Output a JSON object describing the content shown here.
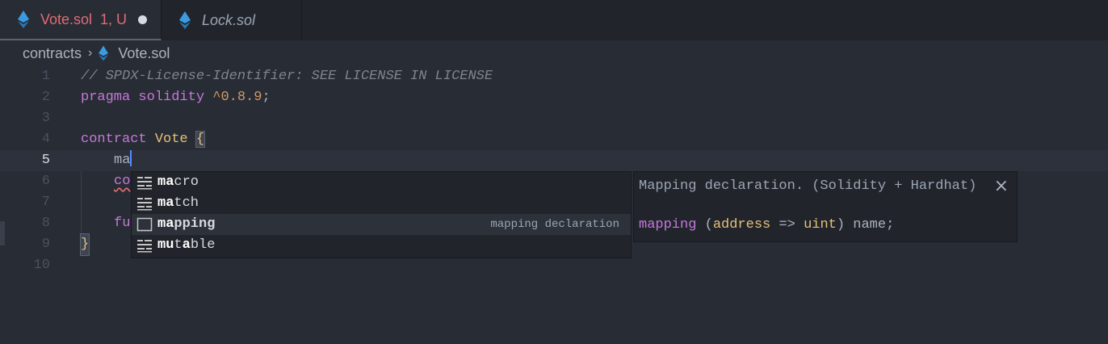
{
  "tabs": [
    {
      "name": "Vote.sol",
      "status": "1, U",
      "active": true,
      "modified": true
    },
    {
      "name": "Lock.sol",
      "active": false
    }
  ],
  "breadcrumb": {
    "folder": "contracts",
    "file": "Vote.sol"
  },
  "editor": {
    "current_line": 5,
    "lines": [
      {
        "n": "1"
      },
      {
        "n": "2"
      },
      {
        "n": "3"
      },
      {
        "n": "4"
      },
      {
        "n": "5"
      },
      {
        "n": "6"
      },
      {
        "n": "7"
      },
      {
        "n": "8"
      },
      {
        "n": "9"
      },
      {
        "n": "10"
      }
    ],
    "code": {
      "l1": "// SPDX-License-Identifier: SEE LICENSE IN LICENSE",
      "l2_kw": "pragma",
      "l2_kw2": "solidity",
      "l2_ver": "^0.8.9",
      "l2_end": ";",
      "l4_kw": "contract",
      "l4_name": "Vote",
      "l4_brace": "{",
      "l5": "ma",
      "l6": "co",
      "l8": "fu",
      "l9": "}"
    }
  },
  "suggest": {
    "items": [
      {
        "match": "ma",
        "rest": "cro",
        "detail": ""
      },
      {
        "match": "ma",
        "rest": "tch",
        "detail": ""
      },
      {
        "match": "ma",
        "rest": "pping",
        "detail": "mapping declaration",
        "selected": true
      },
      {
        "match": "mu",
        "mid": "t",
        "match2": "a",
        "rest": "ble",
        "detail": ""
      }
    ]
  },
  "details": {
    "title": "Mapping declaration. (Solidity + Hardhat)",
    "close": "×",
    "snippet": {
      "kw": "mapping",
      "open": "(",
      "t1": "address",
      "arrow": "=>",
      "t2": "uint",
      "close": ")",
      "name": "name;"
    }
  },
  "colors": {
    "keyword": "#c678dd",
    "type": "#e5c07b",
    "comment": "#7f848e",
    "number": "#d19a66",
    "caret": "#528bff",
    "error": "#e06c75",
    "ethereum": "#3b9ae1"
  }
}
